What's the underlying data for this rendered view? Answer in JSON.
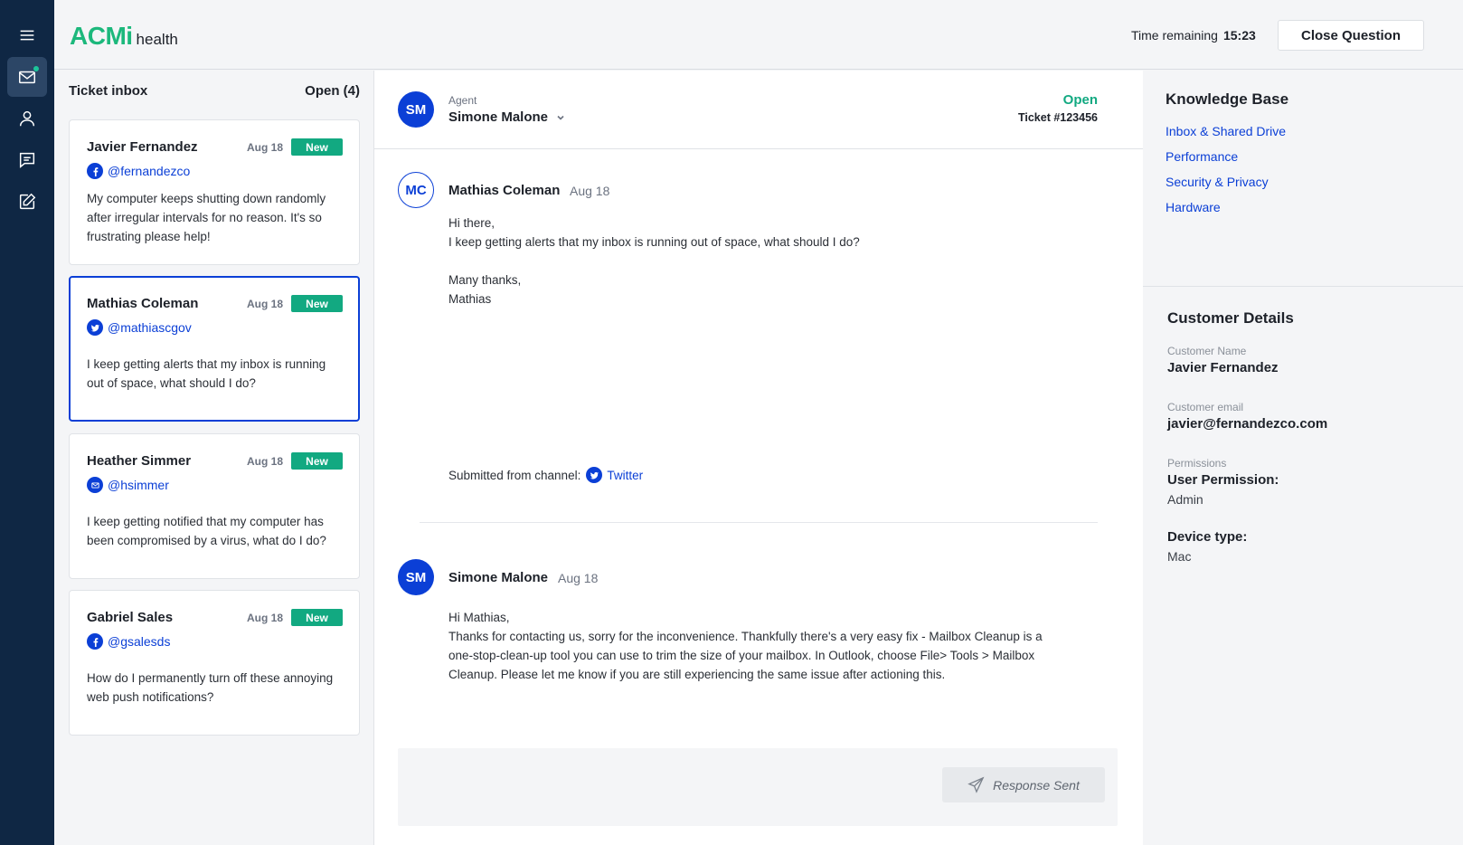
{
  "app": {
    "logo_brand": "ACMi",
    "logo_suffix": "health"
  },
  "header": {
    "timer_label": "Time remaining",
    "timer_value": "15:23",
    "close_button": "Close Question"
  },
  "rail": {
    "icons": [
      "menu-icon",
      "mail-icon",
      "user-icon",
      "chat-icon",
      "edit-icon"
    ]
  },
  "inbox": {
    "title": "Ticket inbox",
    "count": "Open (4)",
    "tickets": [
      {
        "name": "Javier Fernandez",
        "date": "Aug 18",
        "badge": "New",
        "channel": "facebook",
        "handle": "@fernandezco",
        "text": "My computer keeps shutting down randomly after irregular intervals for no reason. It's so frustrating please help!"
      },
      {
        "name": "Mathias Coleman",
        "date": "Aug 18",
        "badge": "New",
        "channel": "twitter",
        "handle": "@mathiascgov",
        "text": "I keep getting alerts that my inbox is running out of space, what should I do?"
      },
      {
        "name": "Heather Simmer",
        "date": "Aug 18",
        "badge": "New",
        "channel": "email",
        "handle": "@hsimmer",
        "text": "I keep getting notified that my computer has been compromised by a virus, what do I do?"
      },
      {
        "name": "Gabriel Sales",
        "date": "Aug 18",
        "badge": "New",
        "channel": "facebook",
        "handle": "@gsalesds",
        "text": "How do I permanently turn off these annoying web push notifications?"
      }
    ]
  },
  "conversation": {
    "agent_label": "Agent",
    "agent_name": "Simone Malone",
    "agent_initials": "SM",
    "status": "Open",
    "ticket_id": "Ticket #123456",
    "message1": {
      "initials": "MC",
      "name": "Mathias Coleman",
      "date": "Aug 18",
      "lines": [
        "Hi there,",
        "I keep getting alerts that my inbox is running out of space, what should I do?",
        "",
        "Many thanks,",
        "Mathias"
      ]
    },
    "channel_label": "Submitted from channel:",
    "channel_name": "Twitter",
    "message2": {
      "initials": "SM",
      "name": "Simone Malone",
      "date": "Aug 18",
      "greeting": "Hi Mathias,",
      "body": "Thanks for contacting us, sorry for the inconvenience. Thankfully there's a very easy fix - Mailbox Cleanup is a one-stop-clean-up tool you can use to trim the size of your mailbox. In Outlook, choose File> Tools > Mailbox Cleanup. Please let me know if you are still experiencing the same issue after actioning this."
    },
    "response_button": "Response Sent"
  },
  "knowledge_base": {
    "title": "Knowledge Base",
    "links": [
      "Inbox & Shared Drive",
      "Performance",
      "Security & Privacy",
      "Hardware"
    ]
  },
  "customer_details": {
    "title": "Customer Details",
    "name_label": "Customer Name",
    "name": "Javier Fernandez",
    "email_label": "Customer email",
    "email": "javier@fernandezco.com",
    "permissions_label": "Permissions",
    "user_permission_label": "User Permission:",
    "user_permission": "Admin",
    "device_label": "Device type:",
    "device": "Mac"
  },
  "colors": {
    "brand": "#1cb87c",
    "accent": "#0b3fd6",
    "status_green": "#12a981",
    "rail": "#0f2744"
  }
}
